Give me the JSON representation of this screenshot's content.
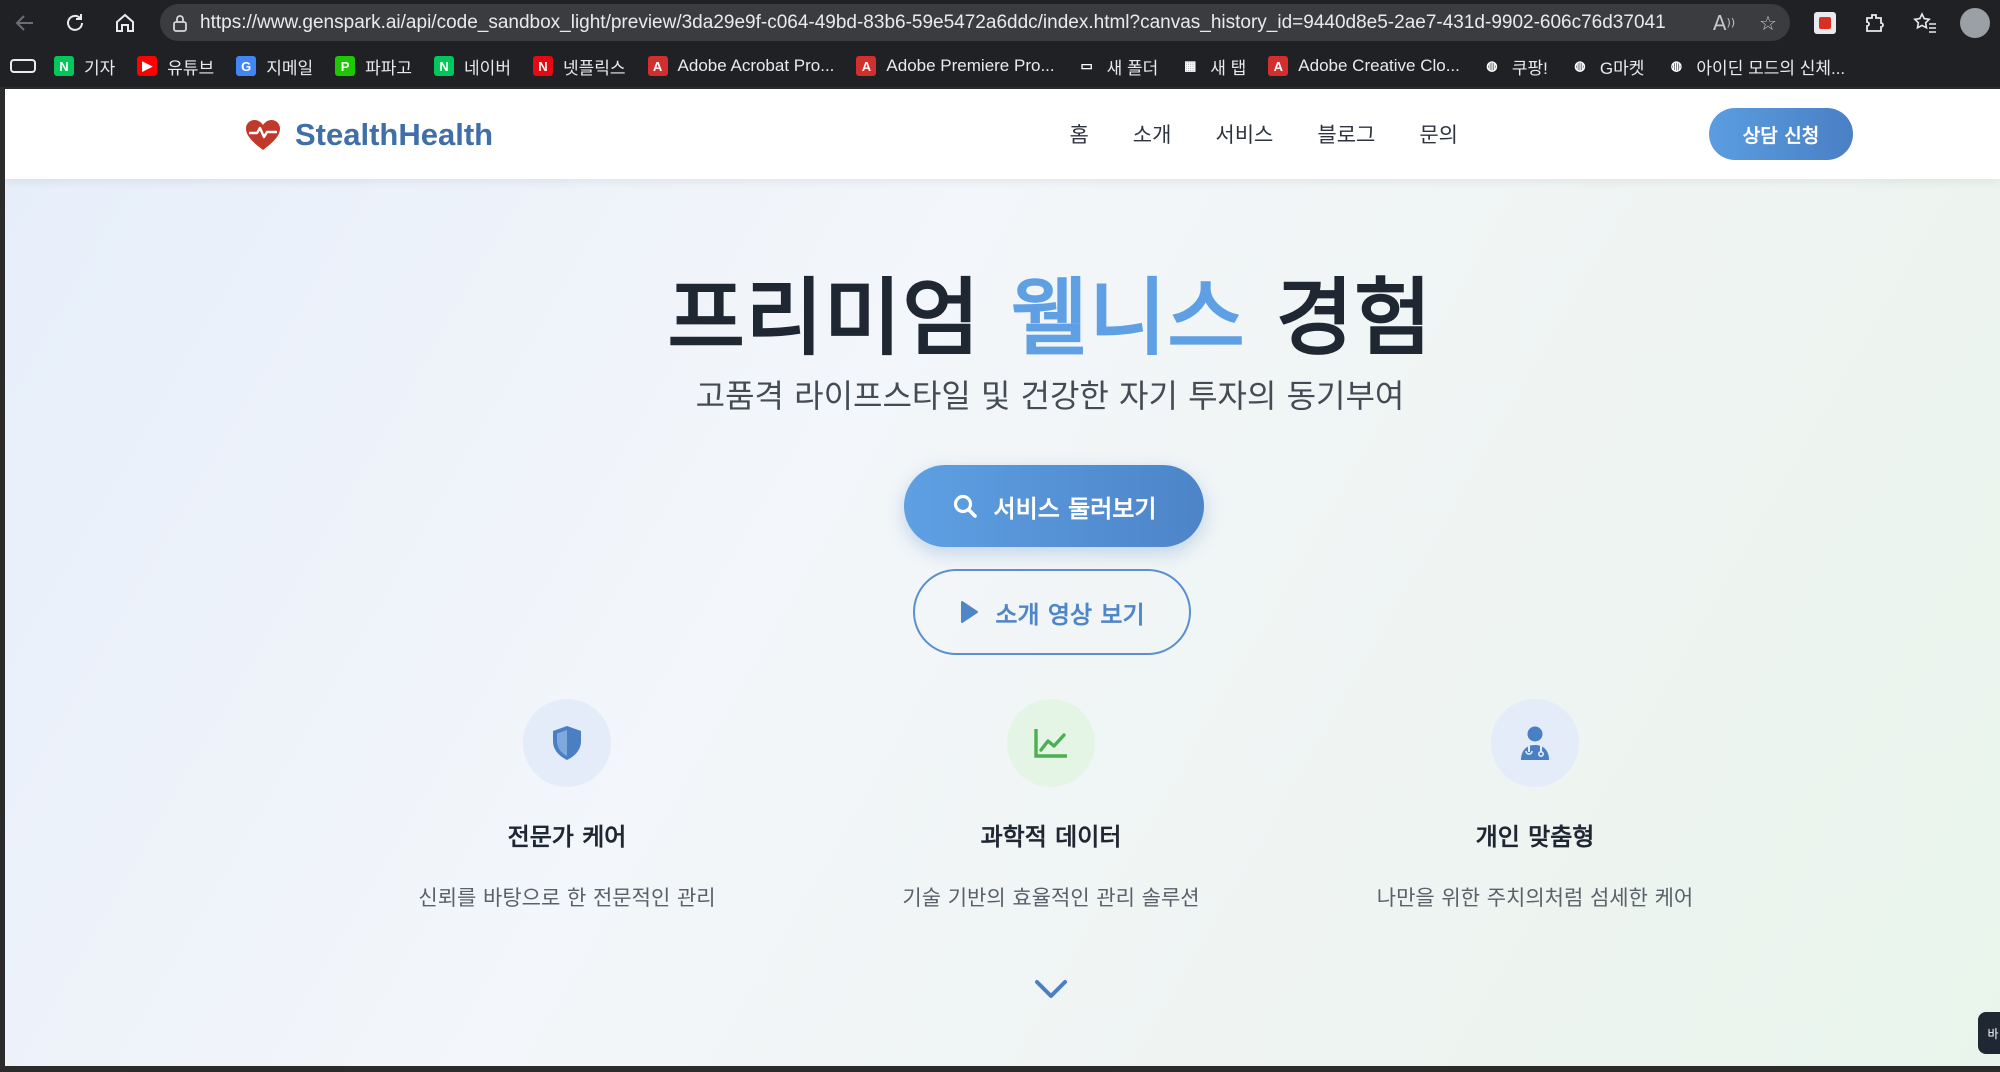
{
  "browser": {
    "url": "https://www.genspark.ai/api/code_sandbox_light/preview/3da29e9f-c064-49bd-83b6-59e5472a6ddc/index.html?canvas_history_id=9440d8e5-2ae7-431d-9902-606c76d37041",
    "bookmarks": [
      {
        "label": "기자",
        "icon": "naver-icon",
        "color": "#03c75a",
        "glyph": "N"
      },
      {
        "label": "유튜브",
        "icon": "youtube-icon",
        "color": "#ff0000",
        "glyph": "▶"
      },
      {
        "label": "지메일",
        "icon": "google-icon",
        "color": "#4285f4",
        "glyph": "G"
      },
      {
        "label": "파파고",
        "icon": "papago-icon",
        "color": "#1ec800",
        "glyph": "P"
      },
      {
        "label": "네이버",
        "icon": "naver-icon",
        "color": "#03c75a",
        "glyph": "N"
      },
      {
        "label": "넷플릭스",
        "icon": "netflix-icon",
        "color": "#e50914",
        "glyph": "N"
      },
      {
        "label": "Adobe Acrobat Pro...",
        "icon": "adobe-icon",
        "color": "#d32f2f",
        "glyph": "A"
      },
      {
        "label": "Adobe Premiere Pro...",
        "icon": "adobe-icon",
        "color": "#d32f2f",
        "glyph": "A"
      },
      {
        "label": "새 폴더",
        "icon": "folder-icon",
        "color": "#202124",
        "glyph": "▭"
      },
      {
        "label": "새 탭",
        "icon": "tab-icon",
        "color": "#202124",
        "glyph": "▦"
      },
      {
        "label": "Adobe Creative Clo...",
        "icon": "adobe-icon",
        "color": "#d32f2f",
        "glyph": "A"
      },
      {
        "label": "쿠팡!",
        "icon": "globe-icon",
        "color": "#202124",
        "glyph": "◍"
      },
      {
        "label": "G마켓",
        "icon": "globe-icon",
        "color": "#202124",
        "glyph": "◍"
      },
      {
        "label": "아이딘 모드의 신체...",
        "icon": "globe-icon",
        "color": "#202124",
        "glyph": "◍"
      }
    ]
  },
  "site": {
    "brand": "StealthHealth",
    "nav": [
      "홈",
      "소개",
      "서비스",
      "블로그",
      "문의"
    ],
    "cta": "상담 신청",
    "hero": {
      "title_before": "프리미엄 ",
      "title_accent": "웰니스",
      "title_after": " 경험",
      "subtitle": "고품격 라이프스타일 및 건강한 자기 투자의 동기부여",
      "primary_button": "서비스 둘러보기",
      "secondary_button": "소개 영상 보기"
    },
    "features": [
      {
        "title": "전문가 케어",
        "desc": "신뢰를 바탕으로 한 전문적인 관리",
        "icon": "shield-icon",
        "bg": "#e3ecf8",
        "fg": "#4a7fc4"
      },
      {
        "title": "과학적 데이터",
        "desc": "기술 기반의 효율적인 관리 솔루션",
        "icon": "chart-line-icon",
        "bg": "#e4f5e6",
        "fg": "#4caf50"
      },
      {
        "title": "개인 맞춤형",
        "desc": "나만을 위한 주치의처럼 섬세한 케어",
        "icon": "user-doctor-icon",
        "bg": "#e3ecf8",
        "fg": "#4a7fc4"
      }
    ],
    "corner_tab": "바"
  },
  "colors": {
    "brand_blue": "#3f6ea8",
    "accent_blue": "#5ea0e3",
    "heart_red": "#c0392b"
  }
}
